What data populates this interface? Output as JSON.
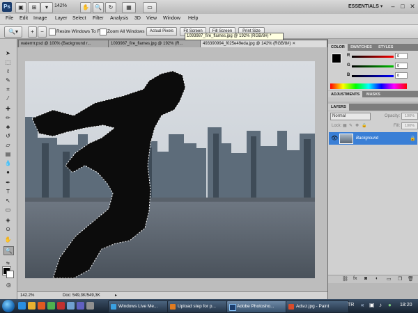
{
  "appbar": {
    "logo": "Ps",
    "zoom_level": "142%",
    "workspace": "ESSENTIALS ▾",
    "window_controls": [
      "–",
      "□",
      "✕"
    ]
  },
  "menu": [
    "File",
    "Edit",
    "Image",
    "Layer",
    "Select",
    "Filter",
    "Analysis",
    "3D",
    "View",
    "Window",
    "Help"
  ],
  "options": {
    "resize_windows": "Resize Windows To Fit",
    "zoom_all": "Zoom All Windows",
    "actual_pixels": "Actual Pixels",
    "fit_screen": "Fit Screen",
    "fill_screen": "Fill Screen",
    "print_size": "Print Size"
  },
  "tooltip": "1093987_fire_flames.jpg @ 192% (RGB/8#) *",
  "doc_tabs": [
    "waterrrr.psd @ 100% (Background r...",
    "1093987_fire_flames.jpg @ 192% (R...",
    "493390994_f025e49eda.jpg @ 142% (RGB/8#)"
  ],
  "status": {
    "zoom": "142.2%",
    "doc": "Doc: 549,3K/549,3K"
  },
  "panels": {
    "color_tabs": [
      "COLOR",
      "SWATCHES",
      "STYLES"
    ],
    "sliders": [
      {
        "label": "R",
        "value": "0",
        "color": "#ff0000"
      },
      {
        "label": "G",
        "value": "0",
        "color": "#00c000"
      },
      {
        "label": "B",
        "value": "0",
        "color": "#0000ff"
      }
    ],
    "adjust_tabs": [
      "ADJUSTMENTS",
      "MASKS"
    ],
    "layers_tab": "LAYERS",
    "blend_mode": "Normal",
    "opacity_label": "Opacity:",
    "opacity_value": "100%",
    "lock_label": "Lock:",
    "fill_label": "Fill:",
    "fill_value": "100%",
    "layer_name": "Background"
  },
  "taskbar": {
    "tasks": [
      {
        "label": "Windows Live Me...",
        "color": "#3aa0e0"
      },
      {
        "label": "Upload step for p...",
        "color": "#e07b20"
      },
      {
        "label": "Adobe Photosho...",
        "color": "#1b3d6d"
      },
      {
        "label": "Adsız.jpg - Paint",
        "color": "#d84b2a"
      }
    ],
    "lang": "TR",
    "clock": "18:20"
  }
}
